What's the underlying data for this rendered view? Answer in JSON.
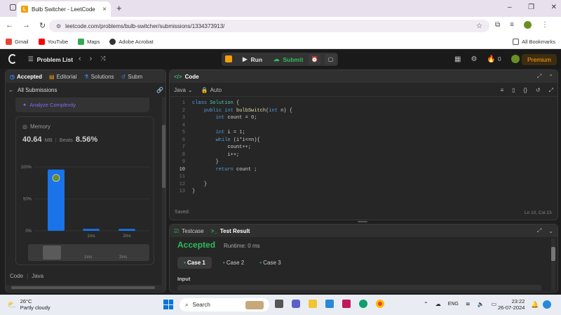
{
  "browser": {
    "tab_title": "Bulb Switcher - LeetCode",
    "tab_close": "×",
    "new_tab": "+",
    "url": "leetcode.com/problems/bulb-switcher/submissions/1334373913/",
    "bookmarks": [
      {
        "label": "Gmail",
        "color": "#ea4335"
      },
      {
        "label": "YouTube",
        "color": "#ff0000"
      },
      {
        "label": "Maps",
        "color": "#34a853"
      },
      {
        "label": "Adobe Acrobat",
        "color": "#333333"
      }
    ],
    "all_bookmarks": "All Bookmarks"
  },
  "nav": {
    "problem_list": "Problem List",
    "run": "Run",
    "submit": "Submit",
    "streak": "0",
    "premium": "Premium"
  },
  "left": {
    "tabs": [
      "Accepted",
      "Editorial",
      "Solutions",
      "Subm"
    ],
    "all_submissions": "All Submissions",
    "analyze": "Analyze Complexity",
    "memory_label": "Memory",
    "memory_value": "40.64",
    "memory_unit": "MB",
    "beats_label": "Beats",
    "beats_value": "8.56%",
    "code_label": "Code",
    "code_lang": "Java"
  },
  "chart_data": {
    "type": "bar",
    "categories": [
      "",
      "1ms",
      "2ms"
    ],
    "values": [
      96,
      3,
      3
    ],
    "ytick_labels": [
      "100%",
      "50%",
      "0%"
    ],
    "ylim": [
      0,
      100
    ],
    "mini_labels": [
      "1ms",
      "2ms"
    ],
    "bar_color": "#1a73e8"
  },
  "editor": {
    "title": "Code",
    "lang": "Java",
    "mode": "Auto",
    "lines": [
      "class Solution {",
      "    public int bulbSwitch(int n) {",
      "        int count = 0;",
      "",
      "        int i = 1;",
      "        while (i*i<=n){",
      "            count++;",
      "            i++;",
      "        }",
      "        return count ;",
      "",
      "    }",
      "}"
    ],
    "status_left": "Saved",
    "status_right": "Ln 10, Col 23"
  },
  "result": {
    "tab_testcase": "Testcase",
    "tab_result": "Test Result",
    "accepted": "Accepted",
    "runtime": "Runtime: 0 ms",
    "cases": [
      "Case 1",
      "Case 2",
      "Case 3"
    ],
    "input_label": "Input"
  },
  "taskbar": {
    "temp": "26°C",
    "weather": "Partly cloudy",
    "search": "Search",
    "lang": "ENG",
    "time": "23:22",
    "date": "26-07-2024"
  }
}
